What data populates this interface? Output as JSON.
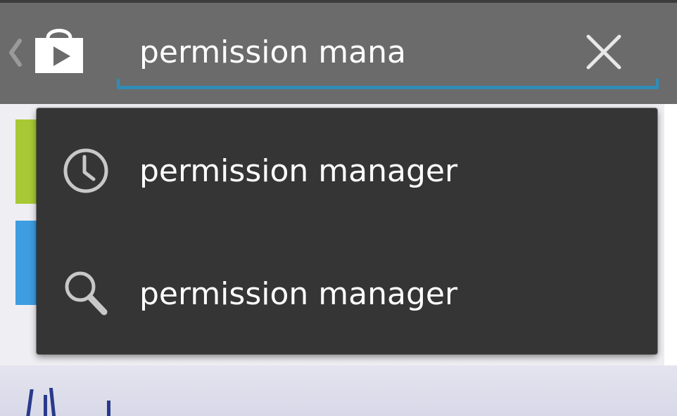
{
  "app": {
    "name": "Google Play Store",
    "colors": {
      "action_bar": "#6b6b6b",
      "accent_underline": "#2f8db8",
      "dropdown_bg": "#353535",
      "text": "#ffffff"
    }
  },
  "action_bar": {
    "up_icon": "chevron-left-icon",
    "logo_icon": "play-store-bag-icon",
    "clear_icon": "close-icon"
  },
  "search": {
    "value": "permission mana",
    "placeholder": ""
  },
  "suggestions": [
    {
      "icon": "clock-icon",
      "type": "recent",
      "label": "permission manager"
    },
    {
      "icon": "search-icon",
      "type": "suggestion",
      "label": "permission manager"
    }
  ]
}
